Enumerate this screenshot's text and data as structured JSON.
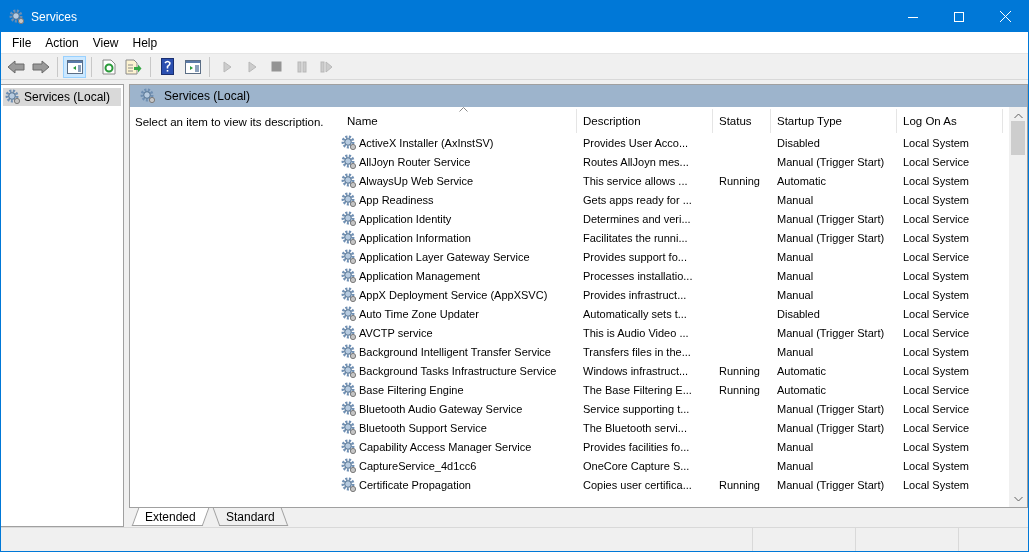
{
  "window": {
    "title": "Services"
  },
  "menu": [
    "File",
    "Action",
    "View",
    "Help"
  ],
  "toolbar": [
    {
      "kind": "back",
      "disabled": false,
      "pressed": false
    },
    {
      "kind": "forward",
      "disabled": false,
      "pressed": false
    },
    {
      "kind": "separator"
    },
    {
      "kind": "tree",
      "disabled": false,
      "pressed": true
    },
    {
      "kind": "separator"
    },
    {
      "kind": "refresh",
      "disabled": false,
      "pressed": false
    },
    {
      "kind": "export",
      "disabled": false,
      "pressed": false
    },
    {
      "kind": "separator"
    },
    {
      "kind": "help",
      "disabled": false,
      "pressed": false
    },
    {
      "kind": "view",
      "disabled": false,
      "pressed": false
    },
    {
      "kind": "separator"
    },
    {
      "kind": "play",
      "disabled": true,
      "pressed": false
    },
    {
      "kind": "play",
      "disabled": true,
      "pressed": false
    },
    {
      "kind": "stop",
      "disabled": true,
      "pressed": false
    },
    {
      "kind": "pause",
      "disabled": true,
      "pressed": false
    },
    {
      "kind": "resume",
      "disabled": true,
      "pressed": false
    }
  ],
  "tree": {
    "items": [
      {
        "label": "Services (Local)",
        "selected": true
      }
    ]
  },
  "panel": {
    "title": "Services (Local)",
    "description": "Select an item to view its description."
  },
  "table": {
    "columns": [
      {
        "label": "Name",
        "sorted": true
      },
      {
        "label": "Description",
        "sorted": false
      },
      {
        "label": "Status",
        "sorted": false
      },
      {
        "label": "Startup Type",
        "sorted": false
      },
      {
        "label": "Log On As",
        "sorted": false
      }
    ],
    "rows": [
      [
        "ActiveX Installer (AxInstSV)",
        "Provides User Acco...",
        "",
        "Disabled",
        "Local System"
      ],
      [
        "AllJoyn Router Service",
        "Routes AllJoyn mes...",
        "",
        "Manual (Trigger Start)",
        "Local Service"
      ],
      [
        "AlwaysUp Web Service",
        "This service allows ...",
        "Running",
        "Automatic",
        "Local System"
      ],
      [
        "App Readiness",
        "Gets apps ready for ...",
        "",
        "Manual",
        "Local System"
      ],
      [
        "Application Identity",
        "Determines and veri...",
        "",
        "Manual (Trigger Start)",
        "Local Service"
      ],
      [
        "Application Information",
        "Facilitates the runni...",
        "",
        "Manual (Trigger Start)",
        "Local System"
      ],
      [
        "Application Layer Gateway Service",
        "Provides support fo...",
        "",
        "Manual",
        "Local Service"
      ],
      [
        "Application Management",
        "Processes installatio...",
        "",
        "Manual",
        "Local System"
      ],
      [
        "AppX Deployment Service (AppXSVC)",
        "Provides infrastruct...",
        "",
        "Manual",
        "Local System"
      ],
      [
        "Auto Time Zone Updater",
        "Automatically sets t...",
        "",
        "Disabled",
        "Local Service"
      ],
      [
        "AVCTP service",
        "This is Audio Video ...",
        "",
        "Manual (Trigger Start)",
        "Local Service"
      ],
      [
        "Background Intelligent Transfer Service",
        "Transfers files in the...",
        "",
        "Manual",
        "Local System"
      ],
      [
        "Background Tasks Infrastructure Service",
        "Windows infrastruct...",
        "Running",
        "Automatic",
        "Local System"
      ],
      [
        "Base Filtering Engine",
        "The Base Filtering E...",
        "Running",
        "Automatic",
        "Local Service"
      ],
      [
        "Bluetooth Audio Gateway Service",
        "Service supporting t...",
        "",
        "Manual (Trigger Start)",
        "Local Service"
      ],
      [
        "Bluetooth Support Service",
        "The Bluetooth servi...",
        "",
        "Manual (Trigger Start)",
        "Local Service"
      ],
      [
        "Capability Access Manager Service",
        "Provides facilities fo...",
        "",
        "Manual",
        "Local System"
      ],
      [
        "CaptureService_4d1cc6",
        "OneCore Capture S...",
        "",
        "Manual",
        "Local System"
      ],
      [
        "Certificate Propagation",
        "Copies user certifica...",
        "Running",
        "Manual (Trigger Start)",
        "Local System"
      ]
    ]
  },
  "view_tabs": [
    {
      "label": "Extended",
      "selected": true
    },
    {
      "label": "Standard",
      "selected": false
    }
  ]
}
